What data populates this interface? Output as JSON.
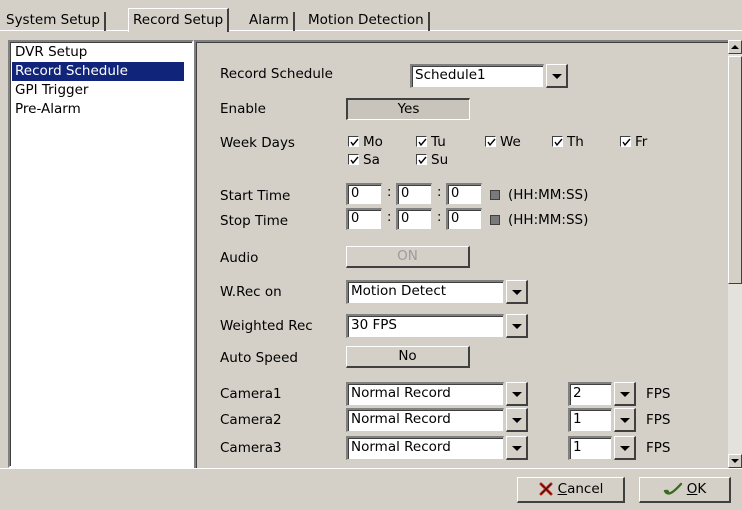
{
  "tabs": [
    {
      "label": "System Setup",
      "active": false
    },
    {
      "label": "Record Setup",
      "active": true
    },
    {
      "label": "Alarm",
      "active": false
    },
    {
      "label": "Motion Detection",
      "active": false
    }
  ],
  "sidebar": {
    "items": [
      {
        "label": "DVR Setup",
        "selected": false
      },
      {
        "label": "Record Schedule",
        "selected": true
      },
      {
        "label": "GPI Trigger",
        "selected": false
      },
      {
        "label": "Pre-Alarm",
        "selected": false
      }
    ]
  },
  "form": {
    "record_schedule": {
      "label": "Record Schedule",
      "value": "Schedule1"
    },
    "enable": {
      "label": "Enable",
      "value": "Yes"
    },
    "week_days": {
      "label": "Week Days",
      "days": [
        {
          "label": "Mo",
          "checked": true
        },
        {
          "label": "Tu",
          "checked": true
        },
        {
          "label": "We",
          "checked": true
        },
        {
          "label": "Th",
          "checked": true
        },
        {
          "label": "Fr",
          "checked": true
        },
        {
          "label": "Sa",
          "checked": true
        },
        {
          "label": "Su",
          "checked": true
        }
      ]
    },
    "start_time": {
      "label": "Start Time",
      "hh": "0",
      "mm": "0",
      "ss": "0",
      "format": "(HH:MM:SS)"
    },
    "stop_time": {
      "label": "Stop Time",
      "hh": "0",
      "mm": "0",
      "ss": "0",
      "format": "(HH:MM:SS)"
    },
    "colon": ":",
    "audio": {
      "label": "Audio",
      "value": "ON"
    },
    "wrec_on": {
      "label": "W.Rec on",
      "value": "Motion Detect"
    },
    "weighted_rec": {
      "label": "Weighted Rec",
      "value": "30 FPS"
    },
    "auto_speed": {
      "label": "Auto Speed",
      "value": "No"
    },
    "cameras": [
      {
        "label": "Camera1",
        "mode": "Normal Record",
        "fps": "2",
        "unit": "FPS"
      },
      {
        "label": "Camera2",
        "mode": "Normal Record",
        "fps": "1",
        "unit": "FPS"
      },
      {
        "label": "Camera3",
        "mode": "Normal Record",
        "fps": "1",
        "unit": "FPS"
      }
    ]
  },
  "footer": {
    "cancel": {
      "prefix": "",
      "underlined": "C",
      "rest": "ancel",
      "icon": "cancel-x-icon"
    },
    "ok": {
      "underlined": "O",
      "rest": "K",
      "icon": "ok-check-icon"
    }
  },
  "colors": {
    "selection": "#10247a",
    "face": "#d4d0c8",
    "cancel_icon": "#c8281e",
    "ok_icon": "#3a6b1e"
  }
}
